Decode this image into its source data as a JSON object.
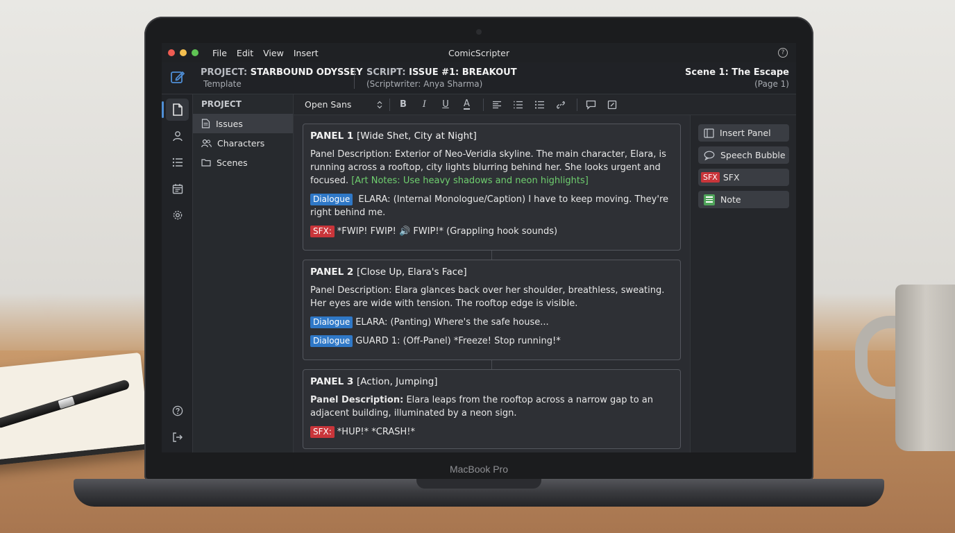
{
  "device": {
    "bezel_label": "MacBook Pro"
  },
  "menubar": {
    "menus": [
      "File",
      "Edit",
      "View",
      "Insert"
    ],
    "app_title": "ComicScripter",
    "help": "?"
  },
  "header": {
    "project_label": "PROJECT:",
    "project_name": "STARBOUND ODYSSEY",
    "project_sub": "Template",
    "script_label": "SCRIPT:",
    "script_name": "ISSUE #1: BREAKOUT",
    "script_sub": "(Scriptwriter: Anya Sharma)",
    "scene_title": "Scene 1: The Escape",
    "scene_page": "(Page 1)"
  },
  "sidebar": {
    "title": "PROJECT",
    "items": [
      {
        "label": "Issues",
        "icon": "document-icon",
        "active": true
      },
      {
        "label": "Characters",
        "icon": "users-icon",
        "active": false
      },
      {
        "label": "Scenes",
        "icon": "folder-icon",
        "active": false
      }
    ]
  },
  "toolbar": {
    "font": "Open Sans",
    "buttons": [
      "B",
      "I",
      "U",
      "A"
    ]
  },
  "panels": [
    {
      "title": "PANEL 1",
      "subtitle": "[Wide Shet, City at Night]",
      "desc_label": "Panel Description:",
      "desc": "Exterior of Neo-Veridia skyline. The main character, Elara, is running across a rooftop, city lights blurring behind her. She looks urgent and focused.",
      "art_note": "[Art Notes: Use heavy shadows and neon highlights]",
      "rows": [
        {
          "tag": "Dialogue",
          "text": "ELARA: (Internal Monologue/Caption) I have to keep moving. They're right behind me."
        },
        {
          "tag": "SFX:",
          "text": "*FWIP! FWIP! 🔊 FWIP!* (Grappling hook sounds)"
        }
      ]
    },
    {
      "title": "PANEL 2",
      "subtitle": "[Close Up, Elara's Face]",
      "desc_label": "Panel Description:",
      "desc": "Elara glances back over her shoulder, breathless, sweating. Her eyes are wide with tension. The rooftop edge is visible.",
      "rows": [
        {
          "tag": "Dialogue",
          "text": "ELARA: (Panting) Where's the safe house..."
        },
        {
          "tag": "Dialogue",
          "text": "GUARD 1: (Off-Panel) *Freeze! Stop running!*"
        }
      ]
    },
    {
      "title": "PANEL 3",
      "subtitle": "[Action, Jumping]",
      "desc_label": "Panel Description:",
      "desc": "Elara leaps from the rooftop across a narrow gap to an adjacent building, illuminated by a neon sign.",
      "rows": [
        {
          "tag": "SFX:",
          "text": "*HUP!* *CRASH!*"
        }
      ]
    }
  ],
  "insert_tools": [
    {
      "label": "Insert Panel",
      "icon": "panel-icon"
    },
    {
      "label": "Speech Bubble",
      "icon": "speech-bubble-icon"
    },
    {
      "label": "SFX",
      "icon": "sfx-icon",
      "badge": "SFX"
    },
    {
      "label": "Note",
      "icon": "note-icon"
    }
  ],
  "colors": {
    "dialogue_tag": "#2f78c7",
    "sfx_tag": "#c9353a",
    "art_note": "#6fcf6f",
    "accent": "#4f8fd6"
  }
}
